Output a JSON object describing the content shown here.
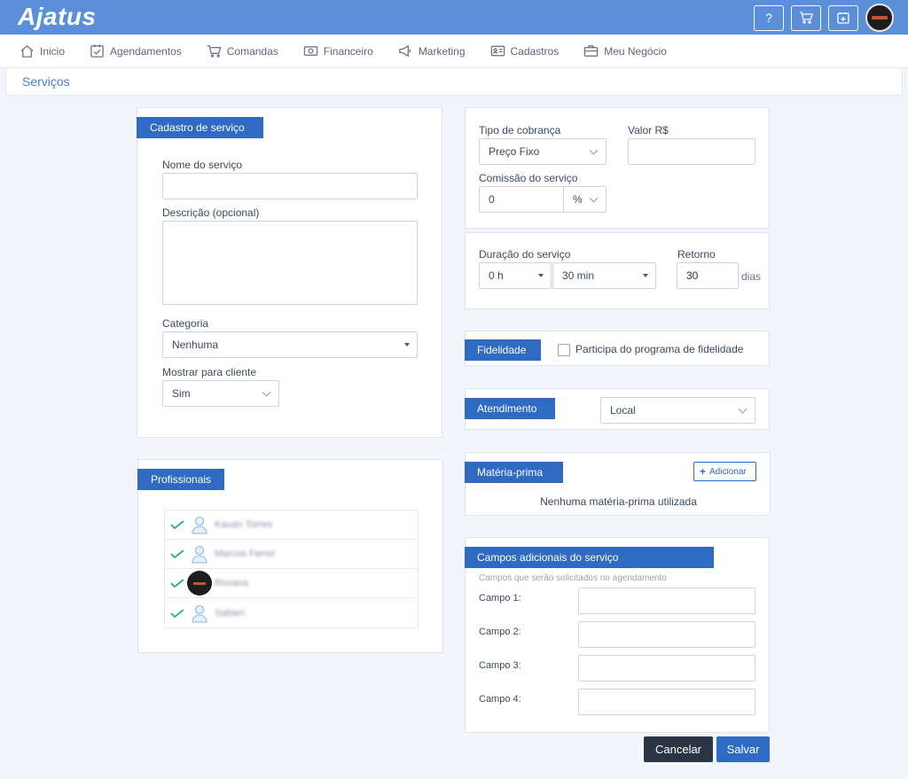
{
  "app": {
    "logo": "Ajatus"
  },
  "topbar": {
    "help_icon_label": "?"
  },
  "nav": [
    {
      "label": "Inicio",
      "icon": "home-icon"
    },
    {
      "label": "Agendamentos",
      "icon": "calendar-check-icon"
    },
    {
      "label": "Comandas",
      "icon": "cart-icon"
    },
    {
      "label": "Financeiro",
      "icon": "money-icon"
    },
    {
      "label": "Marketing",
      "icon": "megaphone-icon"
    },
    {
      "label": "Cadastros",
      "icon": "id-card-icon"
    },
    {
      "label": "Meu Negócio",
      "icon": "briefcase-icon"
    }
  ],
  "page": {
    "title": "Serviços"
  },
  "cadastro": {
    "tab": "Cadastro de serviço",
    "nome_label": "Nome do serviço",
    "nome_value": "",
    "descricao_label": "Descrição (opcional)",
    "descricao_value": "",
    "categoria_label": "Categoria",
    "categoria_value": "Nenhuma",
    "mostrar_label": "Mostrar para cliente",
    "mostrar_value": "Sim"
  },
  "profissionais": {
    "tab": "Profissionais",
    "rows": [
      {
        "name": "Kauan Torres",
        "avatar": "user-icon"
      },
      {
        "name": "Marcos Ferrer",
        "avatar": "user-icon"
      },
      {
        "name": "Roxana",
        "avatar": "photo"
      },
      {
        "name": "Sabien",
        "avatar": "user-icon"
      }
    ]
  },
  "cobranca": {
    "tipo_label": "Tipo de cobrança",
    "tipo_value": "Preço Fixo",
    "valor_label": "Valor R$",
    "valor_value": "",
    "comissao_label": "Comissão do serviço",
    "comissao_value": "0",
    "comissao_unit": "%"
  },
  "duracao": {
    "label": "Duração do serviço",
    "hours_value": "0 h",
    "minutes_value": "30 min",
    "retorno_label": "Retorno",
    "retorno_value": "30",
    "retorno_unit": "dias"
  },
  "fidelidade": {
    "tab": "Fidelidade",
    "checkbox_label": "Participa do programa de fidelidade",
    "checked": false
  },
  "atendimento": {
    "tab": "Atendimento",
    "value": "Local"
  },
  "materia": {
    "tab": "Matéria-prima",
    "add_label": "Adicionar",
    "empty_text": "Nenhuma matéria-prima utilizada"
  },
  "campos": {
    "tab": "Campos adicionais do serviço",
    "subtitle": "Campos que serão solicitados no agendamento",
    "fields": [
      {
        "label": "Campo 1:",
        "value": ""
      },
      {
        "label": "Campo 2:",
        "value": ""
      },
      {
        "label": "Campo 3:",
        "value": ""
      },
      {
        "label": "Campo 4:",
        "value": ""
      }
    ]
  },
  "actions": {
    "cancel": "Cancelar",
    "save": "Salvar"
  },
  "colors": {
    "primary": "#2f6bc2",
    "topbar": "#5b8fd9",
    "cancel": "#2b3544",
    "check": "#2aa89a"
  }
}
